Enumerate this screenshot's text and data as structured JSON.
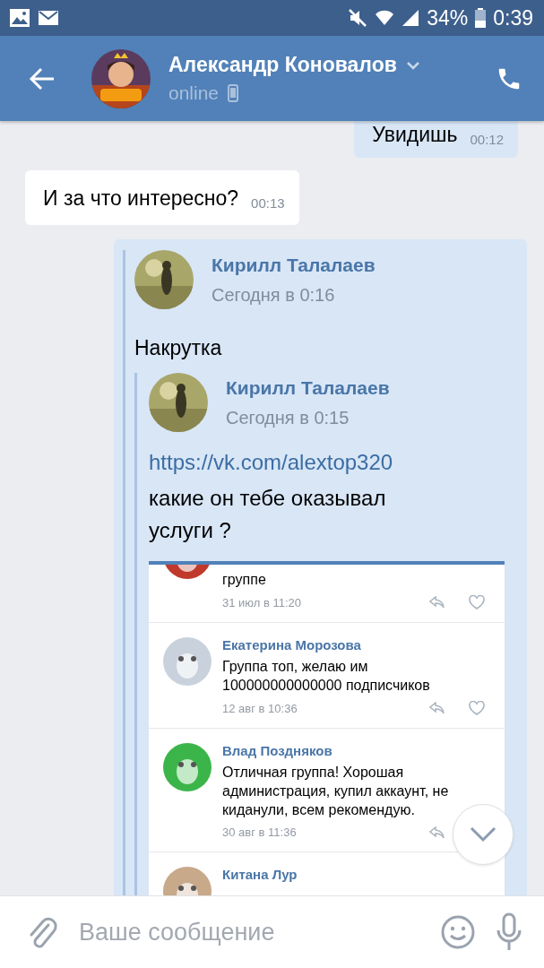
{
  "status_bar": {
    "battery": "34%",
    "time": "0:39"
  },
  "header": {
    "name": "Александр Коновалов",
    "status": "online"
  },
  "messages": [
    {
      "kind": "outgoing",
      "text": "Увидишь",
      "time": "00:12"
    },
    {
      "kind": "incoming",
      "text": "И за что интересно?",
      "time": "00:13"
    }
  ],
  "forward": {
    "author": "Кирилл Талалаев",
    "date": "Сегодня в 0:16",
    "text": "Накрутка",
    "nested": {
      "author": "Кирилл Талалаев",
      "date": "Сегодня в 0:15",
      "link": "https://vk.com/alextop320",
      "text": "какие он тебе оказывал услуги ?",
      "comments": [
        {
          "text": "группе",
          "date": "31 июл в 11:20",
          "actions": [
            {
              "kind": "reply"
            },
            {
              "kind": "like"
            }
          ]
        },
        {
          "author": "Екатерина Морозова",
          "text": "Группа топ, желаю им 100000000000000 подписчиков",
          "date": "12 авг в 10:36",
          "actions": [
            {
              "kind": "reply"
            },
            {
              "kind": "like"
            }
          ]
        },
        {
          "author": "Влад Поздняков",
          "text": "Отличная группа!  Хорошая администрация,  купил аккаунт,  не киданули,  всем рекомендую.",
          "date": "30 авг в 11:36",
          "actions": [
            {
              "kind": "reply"
            }
          ]
        },
        {
          "author": "Китана Лур"
        }
      ]
    }
  },
  "composer": {
    "placeholder": "Ваше сообщение"
  }
}
